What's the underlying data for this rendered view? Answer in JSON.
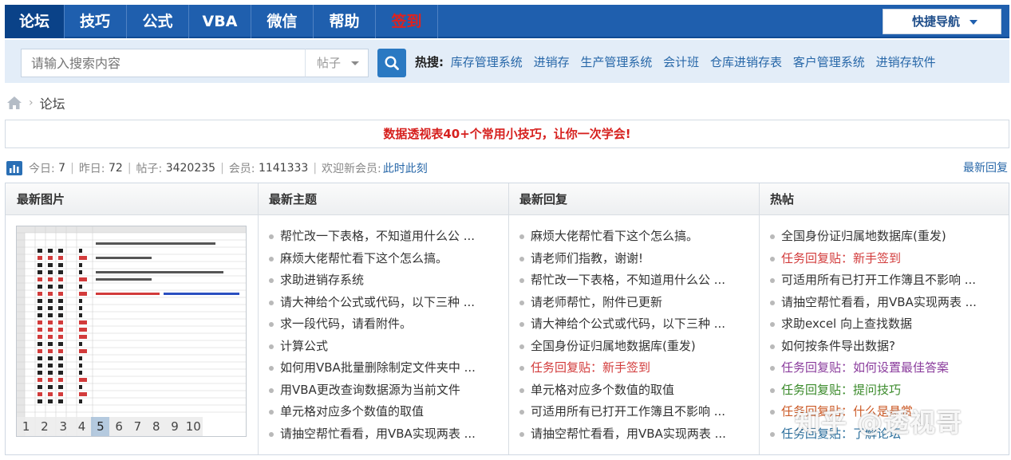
{
  "nav": {
    "items": [
      {
        "label": "论坛",
        "active": true
      },
      {
        "label": "技巧",
        "active": false
      },
      {
        "label": "公式",
        "active": false
      },
      {
        "label": "VBA",
        "active": false
      },
      {
        "label": "微信",
        "active": false
      },
      {
        "label": "帮助",
        "active": false
      },
      {
        "label": "签到",
        "active": false,
        "color": "#e2211c"
      }
    ],
    "quick_nav_label": "快捷导航"
  },
  "search": {
    "placeholder": "请输入搜索内容",
    "type_selected": "帖子",
    "hot_label": "热搜:",
    "hot_links": [
      "库存管理系统",
      "进销存",
      "生产管理系统",
      "会计班",
      "仓库进销存表",
      "客户管理系统",
      "进销存软件"
    ]
  },
  "breadcrumb": {
    "current": "论坛"
  },
  "banner": {
    "text": "数据透视表40+个常用小技巧，让你一次学会!"
  },
  "stats": {
    "today_label": "今日:",
    "today_value": "7",
    "yesterday_label": "昨日:",
    "yesterday_value": "72",
    "posts_label": "帖子:",
    "posts_value": "3420235",
    "members_label": "会员:",
    "members_value": "1141333",
    "welcome_label": "欢迎新会员:",
    "newest_member": "此时此刻",
    "right_link": "最新回复"
  },
  "panel": {
    "columns": [
      "最新图片",
      "最新主题",
      "最新回复",
      "热帖"
    ],
    "pager": [
      "1",
      "2",
      "3",
      "4",
      "5",
      "6",
      "7",
      "8",
      "9",
      "10"
    ],
    "pager_active": "5",
    "latest_topics": [
      {
        "text": "帮忙改一下表格，不知道用什么公 ...",
        "style": ""
      },
      {
        "text": "麻烦大佬帮忙看下这个怎么搞。",
        "style": ""
      },
      {
        "text": "求助进销存系统",
        "style": ""
      },
      {
        "text": "请大神给个公式或代码，以下三种 ...",
        "style": ""
      },
      {
        "text": "求一段代码，请看附件。",
        "style": ""
      },
      {
        "text": "计算公式",
        "style": ""
      },
      {
        "text": "如何用VBA批量删除制定文件夹中 ...",
        "style": ""
      },
      {
        "text": "用VBA更改查询数据源为当前文件",
        "style": ""
      },
      {
        "text": "单元格对应多个数值的取值",
        "style": ""
      },
      {
        "text": "请抽空帮忙看看，用VBA实现两表 ...",
        "style": ""
      }
    ],
    "latest_replies": [
      {
        "text": "麻烦大佬帮忙看下这个怎么搞。",
        "style": ""
      },
      {
        "text": "请老师们指教，谢谢!",
        "style": ""
      },
      {
        "text": "帮忙改一下表格，不知道用什么公 ...",
        "style": ""
      },
      {
        "text": "请老师帮忙，附件已更新",
        "style": ""
      },
      {
        "text": "请大神给个公式或代码，以下三种 ...",
        "style": ""
      },
      {
        "text": "全国身份证归属地数据库(重发)",
        "style": ""
      },
      {
        "text": "任务回复贴：新手签到",
        "style": "red"
      },
      {
        "text": "单元格对应多个数值的取值",
        "style": ""
      },
      {
        "text": "可适用所有已打开工作簿且不影响 ...",
        "style": ""
      },
      {
        "text": "请抽空帮忙看看，用VBA实现两表 ...",
        "style": ""
      }
    ],
    "hot_posts": [
      {
        "text": "全国身份证归属地数据库(重发)",
        "style": ""
      },
      {
        "text": "任务回复贴：新手签到",
        "style": "red"
      },
      {
        "text": "可适用所有已打开工作簿且不影响 ...",
        "style": ""
      },
      {
        "text": "请抽空帮忙看看，用VBA实现两表 ...",
        "style": ""
      },
      {
        "text": "求助excel 向上查找数据",
        "style": ""
      },
      {
        "text": "如何按条件导出数据?",
        "style": ""
      },
      {
        "text": "任务回复贴：如何设置最佳答案",
        "style": "purple"
      },
      {
        "text": "任务回复贴：提问技巧",
        "style": "green"
      },
      {
        "text": "任务回复贴：什么是悬赏",
        "style": "orange"
      },
      {
        "text": "任务回复贴：了解论坛",
        "style": "teal"
      }
    ]
  },
  "watermark": "知乎 @透视哥"
}
